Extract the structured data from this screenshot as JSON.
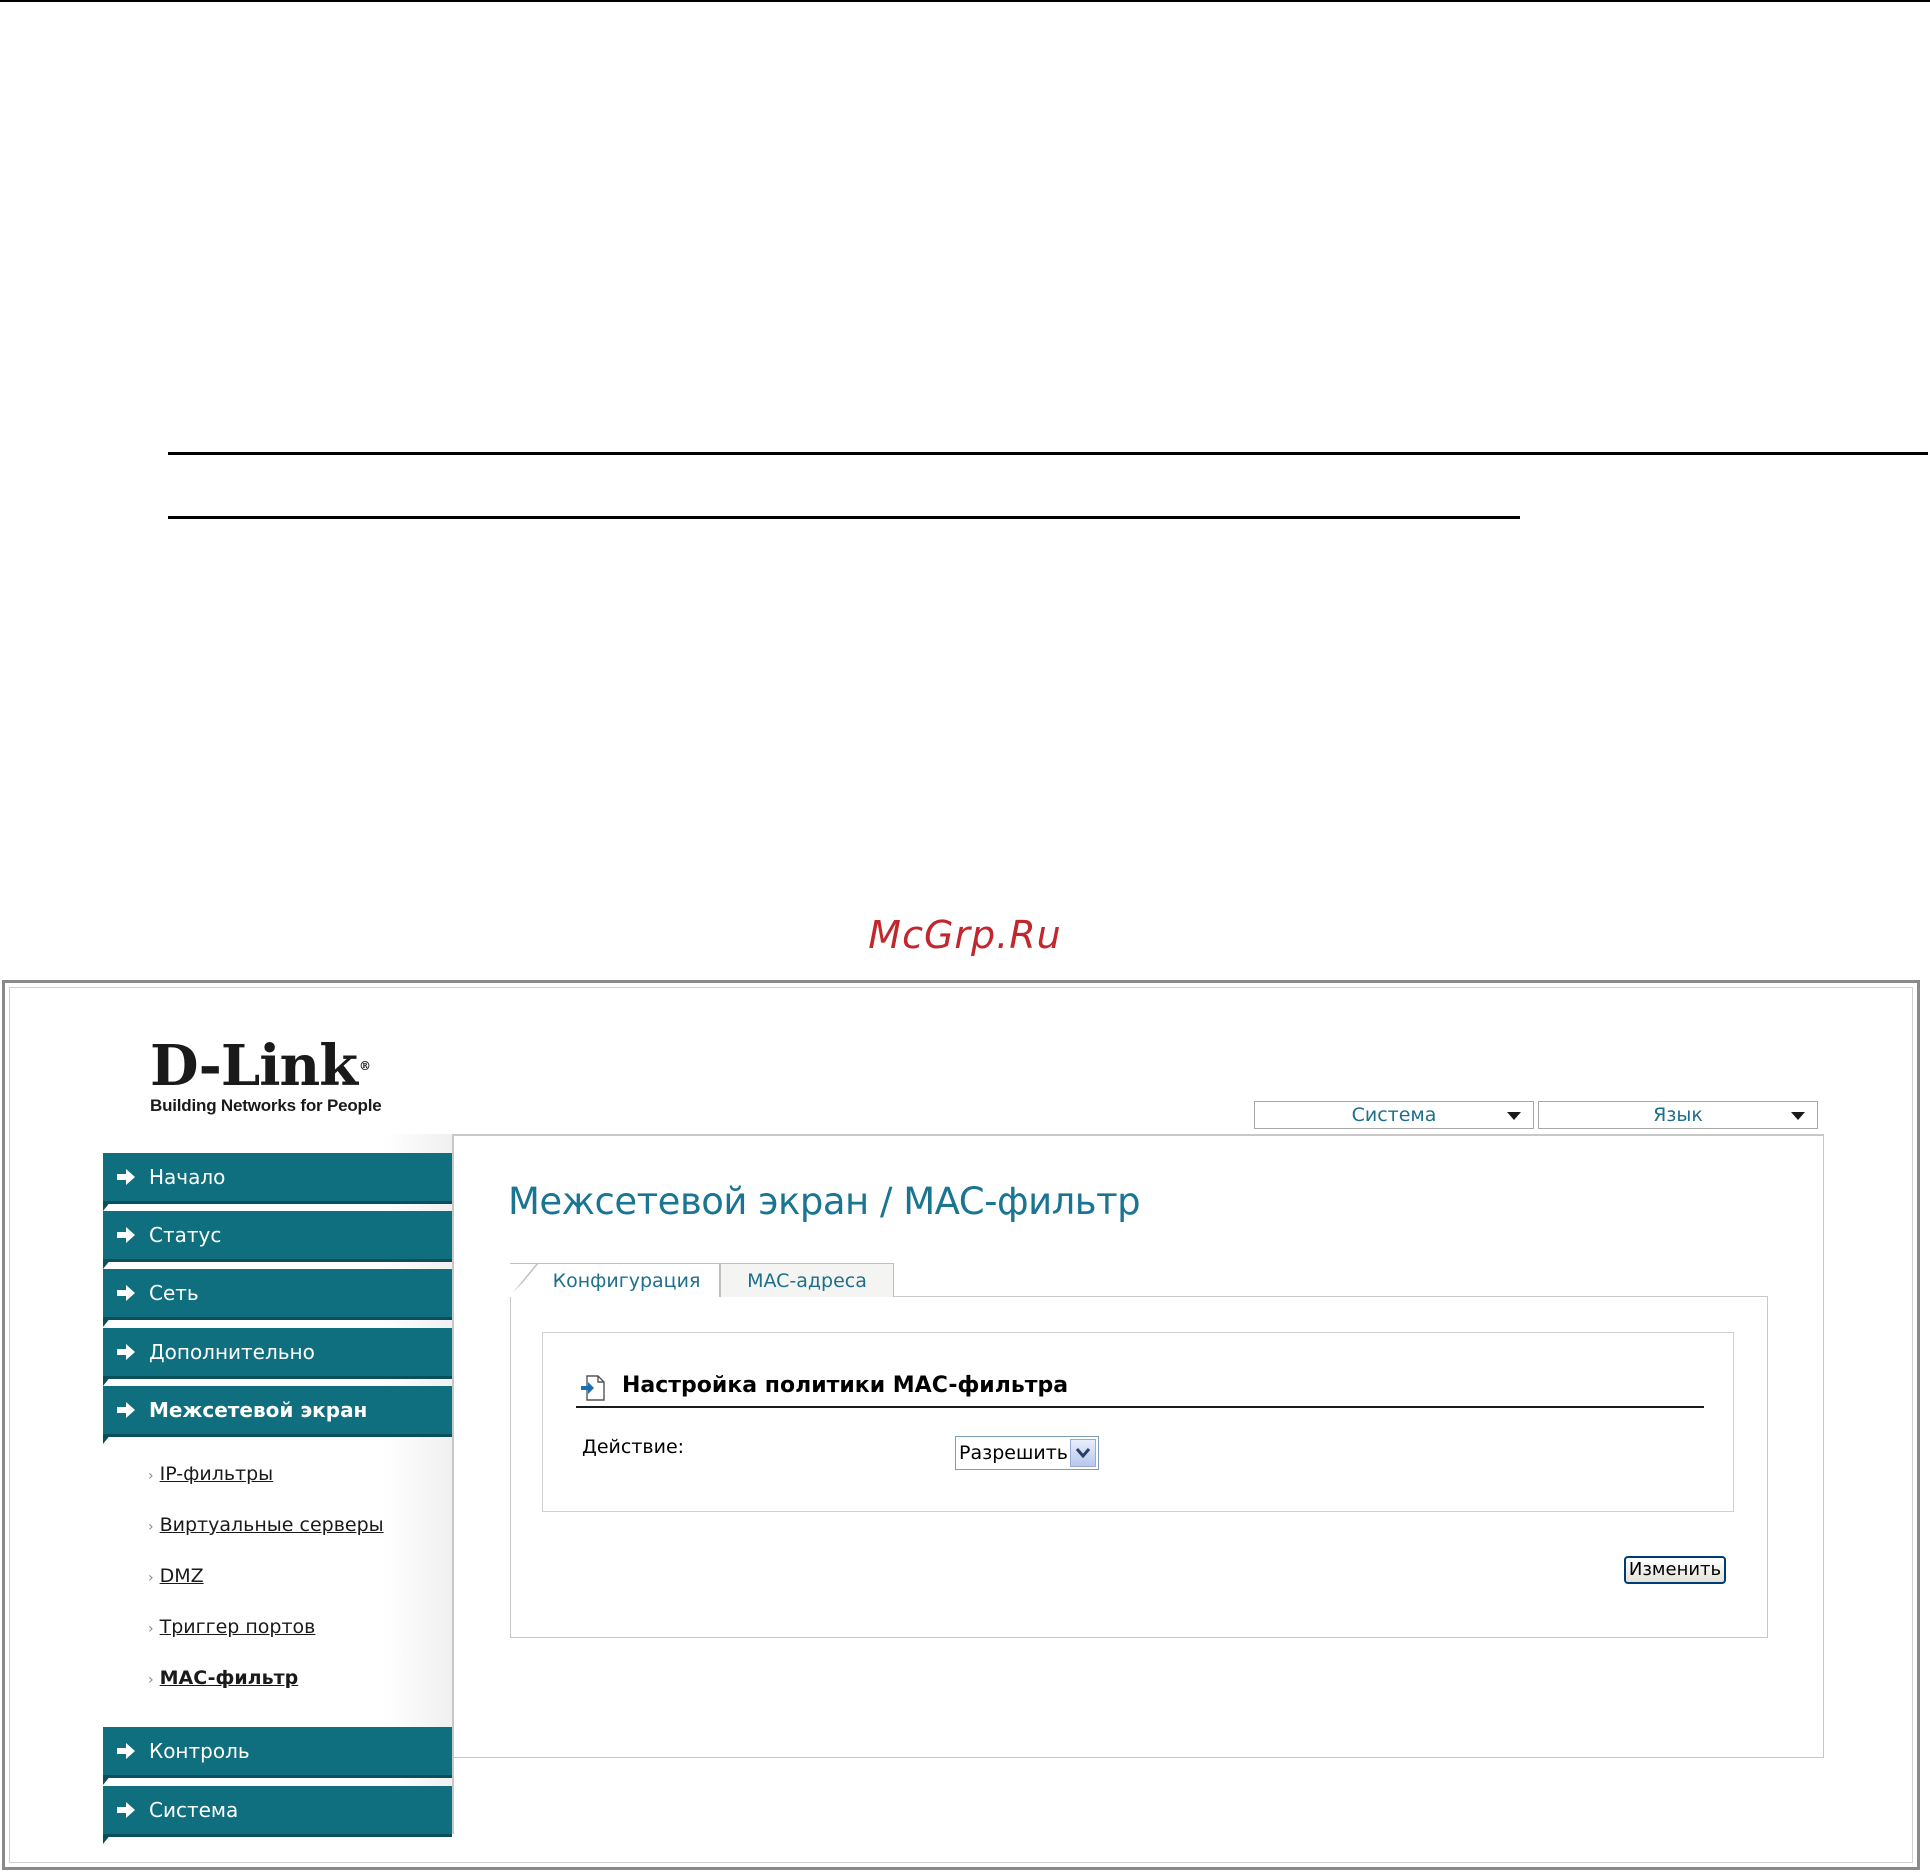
{
  "watermark": "McGrp.Ru",
  "logo": {
    "word": "D-Link",
    "registered": "®",
    "tagline": "Building Networks for People"
  },
  "top_menu": {
    "system": "Система",
    "language": "Язык"
  },
  "nav": {
    "items": [
      {
        "label": "Начало"
      },
      {
        "label": "Статус"
      },
      {
        "label": "Сеть"
      },
      {
        "label": "Дополнительно"
      },
      {
        "label": "Межсетевой экран",
        "active": true
      },
      {
        "label": "Контроль"
      },
      {
        "label": "Система"
      }
    ],
    "firewall_sub": [
      {
        "label": "IP-фильтры"
      },
      {
        "label": "Виртуальные серверы"
      },
      {
        "label": "DMZ"
      },
      {
        "label": "Триггер портов"
      },
      {
        "label": "MAC-фильтр",
        "active": true
      }
    ]
  },
  "page": {
    "title": "Межсетевой экран / MAC-фильтр",
    "tabs": [
      {
        "label": "Конфигурация",
        "active": true
      },
      {
        "label": "MAC-адреса"
      }
    ],
    "section_title": "Настройка политики MAC-фильтра",
    "action_label": "Действие:",
    "action_value": "Разрешить",
    "apply_label": "Изменить"
  },
  "colors": {
    "nav_bg": "#0f6f7f",
    "title": "#1a7593",
    "watermark": "#c1272d"
  }
}
